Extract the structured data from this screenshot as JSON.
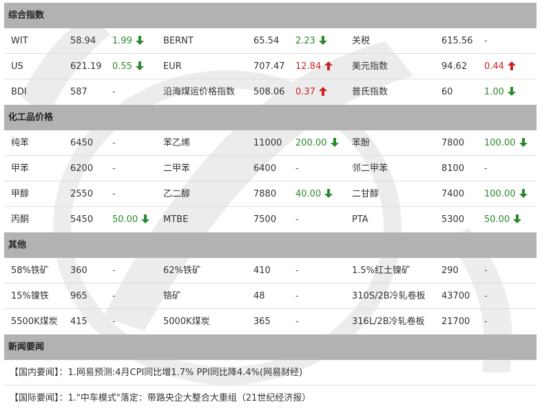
{
  "colors": {
    "header_bg": "#b2b2b2",
    "down": "#2a8a2a",
    "up": "#cc2222",
    "divider": "#dcdcdc"
  },
  "sections": [
    {
      "title": "综合指数",
      "rows": [
        [
          {
            "name": "WIT",
            "value": "58.94",
            "change": "1.99",
            "dir": "down"
          },
          {
            "name": "BERNT",
            "value": "65.54",
            "change": "2.23",
            "dir": "down"
          },
          {
            "name": "关税",
            "value": "615.56",
            "change": "-",
            "dir": "none"
          }
        ],
        [
          {
            "name": "US",
            "value": "621.19",
            "change": "0.55",
            "dir": "down"
          },
          {
            "name": "EUR",
            "value": "707.47",
            "change": "12.84",
            "dir": "up"
          },
          {
            "name": "美元指数",
            "value": "94.62",
            "change": "0.44",
            "dir": "up"
          }
        ],
        [
          {
            "name": "BDI",
            "value": "587",
            "change": "-",
            "dir": "none"
          },
          {
            "name": "沿海煤运价格指数",
            "value": "508.06",
            "change": "0.37",
            "dir": "up"
          },
          {
            "name": "普氏指数",
            "value": "60",
            "change": "1.00",
            "dir": "down"
          }
        ]
      ]
    },
    {
      "title": "化工品价格",
      "rows": [
        [
          {
            "name": "纯苯",
            "value": "6450",
            "change": "-",
            "dir": "none"
          },
          {
            "name": "苯乙烯",
            "value": "11000",
            "change": "200.00",
            "dir": "down"
          },
          {
            "name": "苯酚",
            "value": "7800",
            "change": "100.00",
            "dir": "down"
          }
        ],
        [
          {
            "name": "甲苯",
            "value": "6200",
            "change": "-",
            "dir": "none"
          },
          {
            "name": "二甲苯",
            "value": "6400",
            "change": "-",
            "dir": "none"
          },
          {
            "name": "邻二甲苯",
            "value": "8100",
            "change": "-",
            "dir": "none"
          }
        ],
        [
          {
            "name": "甲醇",
            "value": "2550",
            "change": "-",
            "dir": "none"
          },
          {
            "name": "乙二醇",
            "value": "7880",
            "change": "40.00",
            "dir": "down"
          },
          {
            "name": "二甘醇",
            "value": "7400",
            "change": "100.00",
            "dir": "down"
          }
        ],
        [
          {
            "name": "丙酮",
            "value": "5450",
            "change": "50.00",
            "dir": "down"
          },
          {
            "name": "MTBE",
            "value": "7500",
            "change": "-",
            "dir": "none"
          },
          {
            "name": "PTA",
            "value": "5300",
            "change": "50.00",
            "dir": "down"
          }
        ]
      ]
    },
    {
      "title": "其他",
      "rows": [
        [
          {
            "name": "58%铁矿",
            "value": "360",
            "change": "-",
            "dir": "none"
          },
          {
            "name": "62%铁矿",
            "value": "410",
            "change": "-",
            "dir": "none"
          },
          {
            "name": "1.5%红土镍矿",
            "value": "290",
            "change": "-",
            "dir": "none"
          }
        ],
        [
          {
            "name": "15%镍铁",
            "value": "965",
            "change": "-",
            "dir": "none"
          },
          {
            "name": "铬矿",
            "value": "48",
            "change": "-",
            "dir": "none"
          },
          {
            "name": "310S/2B冷轧卷板",
            "value": "43700",
            "change": "-",
            "dir": "none"
          }
        ],
        [
          {
            "name": "5500K煤炭",
            "value": "415",
            "change": "-",
            "dir": "none"
          },
          {
            "name": "5000K煤炭",
            "value": "365",
            "change": "-",
            "dir": "none"
          },
          {
            "name": "316L/2B冷轧卷板",
            "value": "21700",
            "change": "-",
            "dir": "none"
          }
        ]
      ]
    }
  ],
  "news": {
    "title": "新闻要闻",
    "items": [
      "【国内要闻】：1.网易预测:4月CPI同比增1.7% PPI同比降4.4%(网易财经)",
      "【国际要闻】：1.\"中车模式\"落定：带路央企大整合大重组（21世纪经济报）"
    ]
  }
}
